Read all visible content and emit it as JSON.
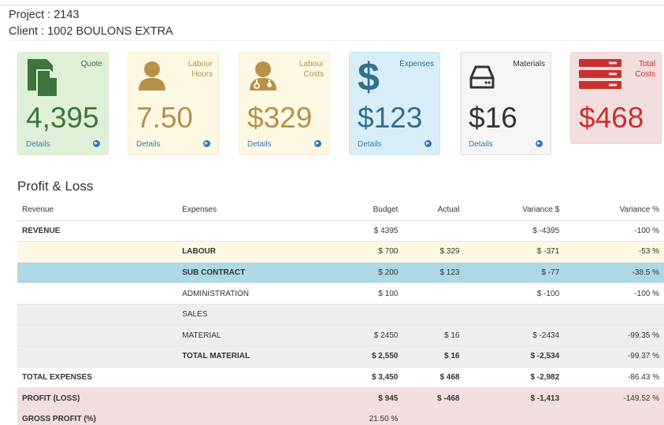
{
  "header": {
    "project": "Project : 2143",
    "client": "Client : 1002 BOULONS EXTRA"
  },
  "cards": [
    {
      "title_line1": "Quote",
      "title_line2": "",
      "value": "4,395",
      "details": "Details",
      "icon": "file-icon",
      "color": "#3c763d"
    },
    {
      "title_line1": "Labour",
      "title_line2": "Hours",
      "value": "7.50",
      "details": "Details",
      "icon": "user-icon",
      "color": "#b7914a"
    },
    {
      "title_line1": "Labour",
      "title_line2": "Costs",
      "value": "$329",
      "details": "Details",
      "icon": "user-md-icon",
      "color": "#b7914a"
    },
    {
      "title_line1": "Expenses",
      "title_line2": "",
      "value": "$123",
      "details": "Details",
      "icon": "dollar-icon",
      "color": "#31708f"
    },
    {
      "title_line1": "Materials",
      "title_line2": "",
      "value": "$16",
      "details": "Details",
      "icon": "hdd-icon",
      "color": "#333333"
    },
    {
      "title_line1": "Total",
      "title_line2": "Costs",
      "value": "$468",
      "details": "",
      "icon": "server-icon",
      "color": "#c9302c"
    }
  ],
  "profit_loss": {
    "title": "Profit & Loss",
    "columns": [
      "Revenue",
      "Expenses",
      "Budget",
      "Actual",
      "Variance $",
      "Variance %"
    ],
    "rows": [
      {
        "revenue": "REVENUE",
        "expense": "",
        "budget": "$ 4395",
        "actual": "",
        "var_d": "$ -4395",
        "var_p": "-100 %"
      },
      {
        "revenue": "",
        "expense": "LABOUR",
        "budget": "$ 700",
        "actual": "$ 329",
        "var_d": "$ -371",
        "var_p": "-53 %"
      },
      {
        "revenue": "",
        "expense": "SUB CONTRACT",
        "budget": "$ 200",
        "actual": "$ 123",
        "var_d": "$ -77",
        "var_p": "-38.5 %"
      },
      {
        "revenue": "",
        "expense": "ADMINISTRATION",
        "budget": "$ 100",
        "actual": "",
        "var_d": "$ -100",
        "var_p": "-100 %"
      },
      {
        "revenue": "",
        "expense": "SALES",
        "budget": "",
        "actual": "",
        "var_d": "",
        "var_p": ""
      },
      {
        "revenue": "",
        "expense": "MATERIAL",
        "budget": "$ 2450",
        "actual": "$ 16",
        "var_d": "$ -2434",
        "var_p": "-99.35 %"
      },
      {
        "revenue": "",
        "expense": "TOTAL MATERIAL",
        "budget": "$ 2,550",
        "actual": "$ 16",
        "var_d": "$ -2,534",
        "var_p": "-99.37 %"
      },
      {
        "revenue": "TOTAL EXPENSES",
        "expense": "",
        "budget": "$ 3,450",
        "actual": "$ 468",
        "var_d": "$ -2,982",
        "var_p": "-86.43 %"
      },
      {
        "revenue": "PROFIT (LOSS)",
        "expense": "",
        "budget": "$ 945",
        "actual": "$ -468",
        "var_d": "$ -1,413",
        "var_p": "-149.52 %"
      },
      {
        "revenue": "GROSS PROFIT (%)",
        "expense": "",
        "budget": "21.50 %",
        "actual": "",
        "var_d": "",
        "var_p": ""
      }
    ]
  }
}
